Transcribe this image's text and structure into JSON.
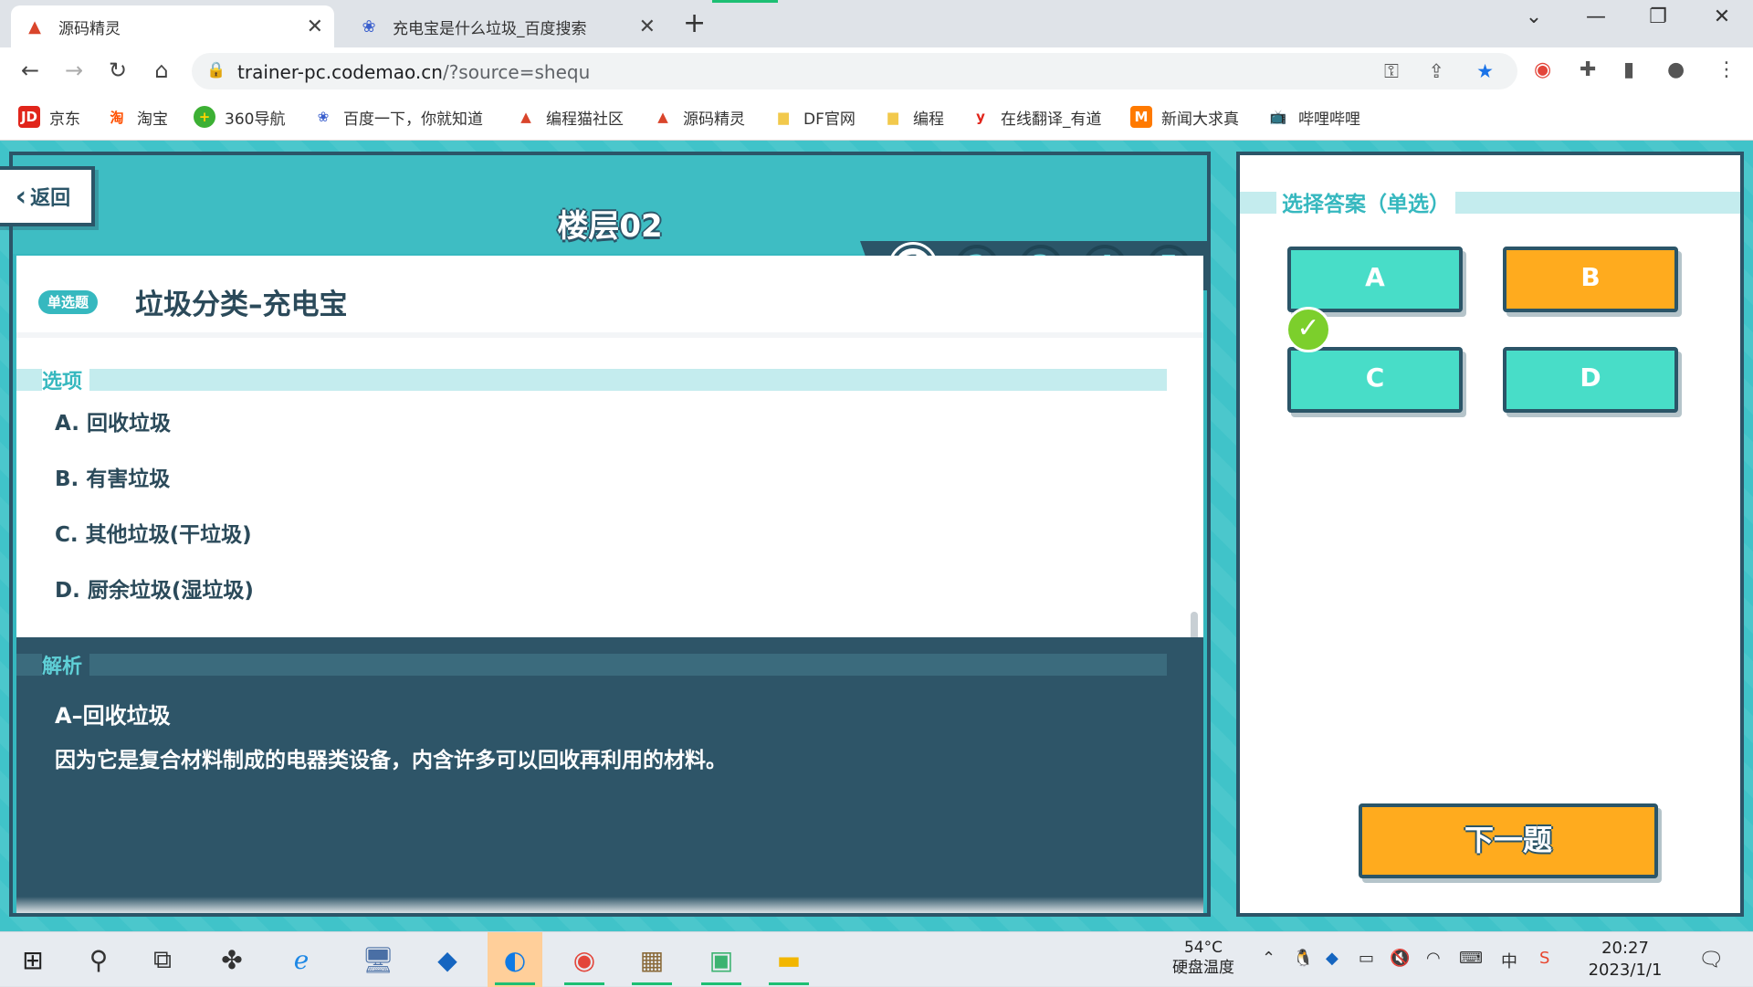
{
  "browser": {
    "tabs": [
      {
        "title": "源码精灵",
        "active": true
      },
      {
        "title": "充电宝是什么垃圾_百度搜索",
        "active": false
      }
    ],
    "url_host": "trainer-pc.codemao.cn",
    "url_path": "/?source=shequ",
    "bookmarks": [
      "京东",
      "淘宝",
      "360导航",
      "百度一下，你就知道",
      "编程猫社区",
      "源码精灵",
      "DF官网",
      "编程",
      "在线翻译_有道",
      "新闻大求真",
      "哔哩哔哩"
    ]
  },
  "quiz": {
    "back_label": "返回",
    "floor_title": "楼层02",
    "steps": [
      "1",
      "2",
      "3",
      "4",
      "5"
    ],
    "active_step": "1",
    "question_type": "单选题",
    "question_title": "垃圾分类–充电宝",
    "options_label": "选项",
    "options": [
      "A. 回收垃圾",
      "B. 有害垃圾",
      "C. 其他垃圾(干垃圾)",
      "D. 厨余垃圾(湿垃圾)"
    ],
    "analysis_label": "解析",
    "answer_title": "A–回收垃圾",
    "answer_text": "因为它是复合材料制成的电器类设备，内含许多可以回收再利用的材料。"
  },
  "answer_panel": {
    "heading": "选择答案（单选）",
    "choices": [
      {
        "label": "A",
        "color": "#48ddc8",
        "correct": true
      },
      {
        "label": "B",
        "color": "#ffab1e",
        "selected": true
      },
      {
        "label": "C",
        "color": "#48ddc8"
      },
      {
        "label": "D",
        "color": "#48ddc8"
      }
    ],
    "next_label": "下一题"
  },
  "taskbar": {
    "temperature": "54°C",
    "temperature_label": "硬盘温度",
    "ime": "中",
    "time": "20:27",
    "date": "2023/1/1"
  },
  "colors": {
    "page_bg": "#40c3c9",
    "dark_border": "#2b5568",
    "teal": "#48ddc8",
    "orange": "#ffab1e",
    "check_green": "#7ccf2c"
  }
}
